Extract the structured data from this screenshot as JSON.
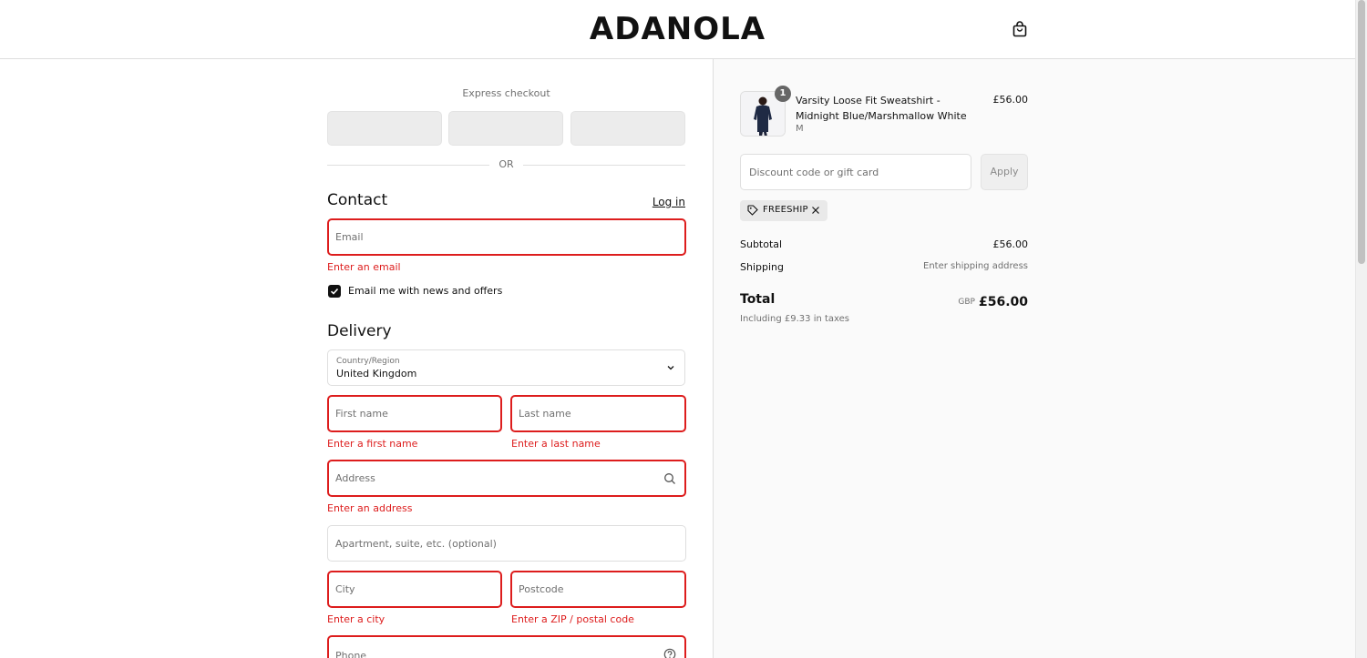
{
  "header": {
    "logo": "ADANOLA",
    "cart_icon": "shopping-bag-icon"
  },
  "express": {
    "title": "Express checkout",
    "divider": "OR"
  },
  "contact": {
    "title": "Contact",
    "login_link": "Log in",
    "email_placeholder": "Email",
    "email_error": "Enter an email",
    "newsletter_label": "Email me with news and offers",
    "newsletter_checked": true
  },
  "delivery": {
    "title": "Delivery",
    "country_label": "Country/Region",
    "country_value": "United Kingdom",
    "first_name_placeholder": "First name",
    "first_name_error": "Enter a first name",
    "last_name_placeholder": "Last name",
    "last_name_error": "Enter a last name",
    "address_placeholder": "Address",
    "address_error": "Enter an address",
    "apartment_placeholder": "Apartment, suite, etc. (optional)",
    "city_placeholder": "City",
    "city_error": "Enter a city",
    "postcode_placeholder": "Postcode",
    "postcode_error": "Enter a ZIP / postal code",
    "phone_placeholder": "Phone"
  },
  "summary": {
    "item": {
      "quantity": "1",
      "name": "Varsity Loose Fit Sweatshirt - Midnight Blue/Marshmallow White",
      "variant": "M",
      "price": "£56.00"
    },
    "discount_placeholder": "Discount code or gift card",
    "apply_label": "Apply",
    "applied_code": "FREESHIP",
    "subtotal_label": "Subtotal",
    "subtotal_value": "£56.00",
    "shipping_label": "Shipping",
    "shipping_value": "Enter shipping address",
    "total_label": "Total",
    "currency": "GBP",
    "total_value": "£56.00",
    "tax_note": "Including £9.33 in taxes"
  },
  "colors": {
    "error": "#dd1d1d",
    "summary_bg": "#fafafa",
    "border": "#dedede"
  }
}
